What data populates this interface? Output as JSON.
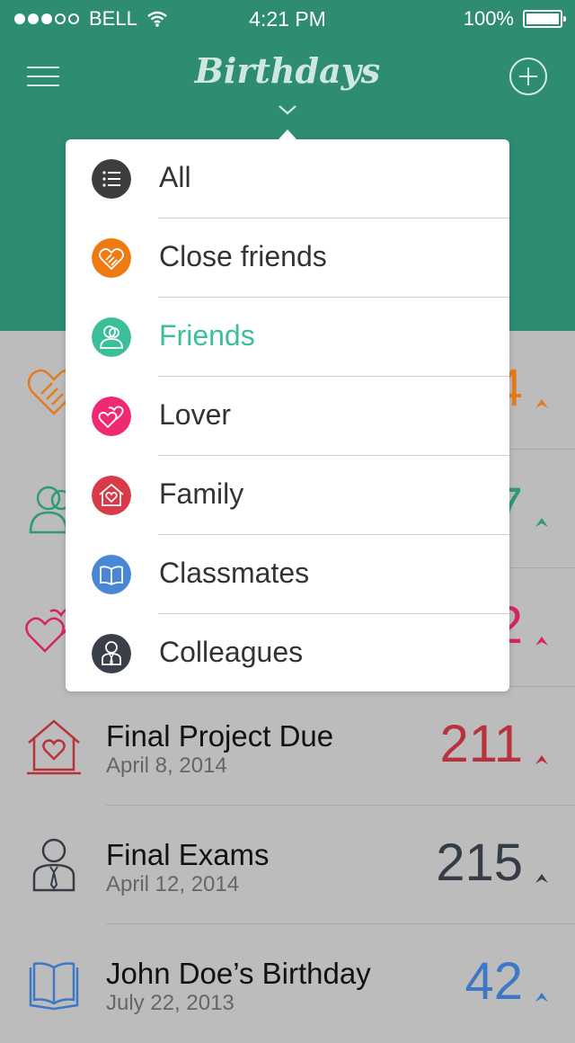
{
  "status_bar": {
    "carrier": "BELL",
    "time": "4:21 PM",
    "battery": "100%"
  },
  "nav": {
    "title": "Birthdays",
    "left_icon": "menu-icon",
    "right_icon": "add-icon"
  },
  "dropdown": {
    "selected": "Friends",
    "items": [
      {
        "label": "All",
        "icon": "list-icon",
        "color": "#3d3d3d"
      },
      {
        "label": "Close  friends",
        "icon": "handshake-heart-icon",
        "color": "#ef7a12"
      },
      {
        "label": "Friends",
        "icon": "people-icon",
        "color": "#3bbf9a"
      },
      {
        "label": "Lover",
        "icon": "hearts-icon",
        "color": "#ee2a72"
      },
      {
        "label": "Family",
        "icon": "house-heart-icon",
        "color": "#d83a48"
      },
      {
        "label": "Classmates",
        "icon": "book-icon",
        "color": "#4a86d6"
      },
      {
        "label": "Colleagues",
        "icon": "businessman-icon",
        "color": "#3a3f4a"
      }
    ]
  },
  "list": {
    "rows": [
      {
        "title": "",
        "date": "",
        "count": "4",
        "icon": "handshake-heart-icon",
        "color": "#e47b1c"
      },
      {
        "title": "",
        "date": "",
        "count": "7",
        "icon": "people-icon",
        "color": "#2e9a78"
      },
      {
        "title": "",
        "date": "",
        "count": "2",
        "icon": "hearts-icon",
        "color": "#d8245c"
      },
      {
        "title": "Final Project Due",
        "date": "April 8, 2014",
        "count": "211",
        "icon": "house-heart-icon",
        "color": "#b8323e"
      },
      {
        "title": "Final Exams",
        "date": "April 12, 2014",
        "count": "215",
        "icon": "businessman-icon",
        "color": "#363c46"
      },
      {
        "title": "John Doe’s Birthday",
        "date": "July 22, 2013",
        "count": "42",
        "icon": "book-icon",
        "color": "#3c78c6"
      }
    ]
  }
}
